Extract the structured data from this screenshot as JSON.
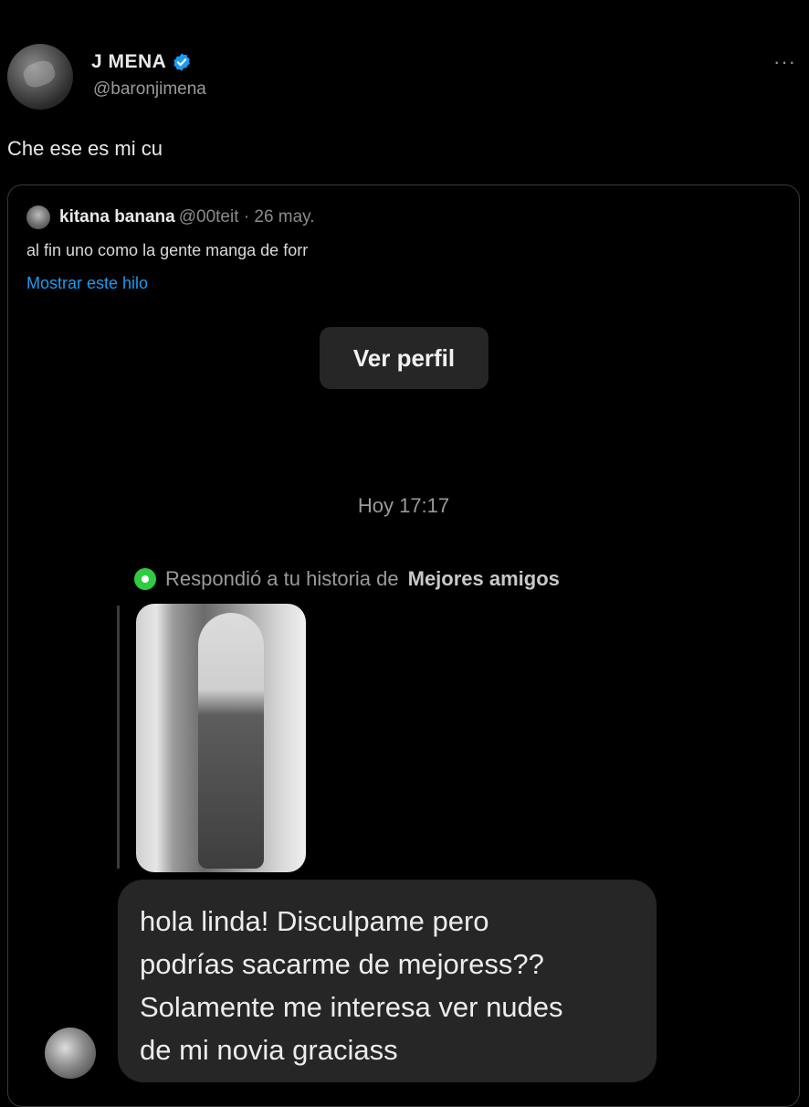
{
  "tweet": {
    "display_name": "J MENA",
    "handle": "@baronjimena",
    "more_label": "···",
    "text": "Che ese es mi cu"
  },
  "quote": {
    "name": "kitana banana",
    "meta": "@00teit · 26 may.",
    "text": "al fin uno como la gente manga de forr",
    "show_thread": "Mostrar este hilo",
    "dm": {
      "view_profile_label": "Ver perfil",
      "timestamp": "Hoy 17:17",
      "story_reply_prefix": "Respondió a tu historia de",
      "story_reply_bold": "Mejores amigos",
      "message": "hola linda! Disculpame pero\npodrías sacarme de mejoress??\nSolamente me interesa ver nudes\nde mi novia graciass"
    }
  },
  "colors": {
    "background": "#000000",
    "link": "#1d9bf0",
    "verified": "#1d9bf0",
    "story_dot": "#2ecc40",
    "bubble": "#262626"
  }
}
